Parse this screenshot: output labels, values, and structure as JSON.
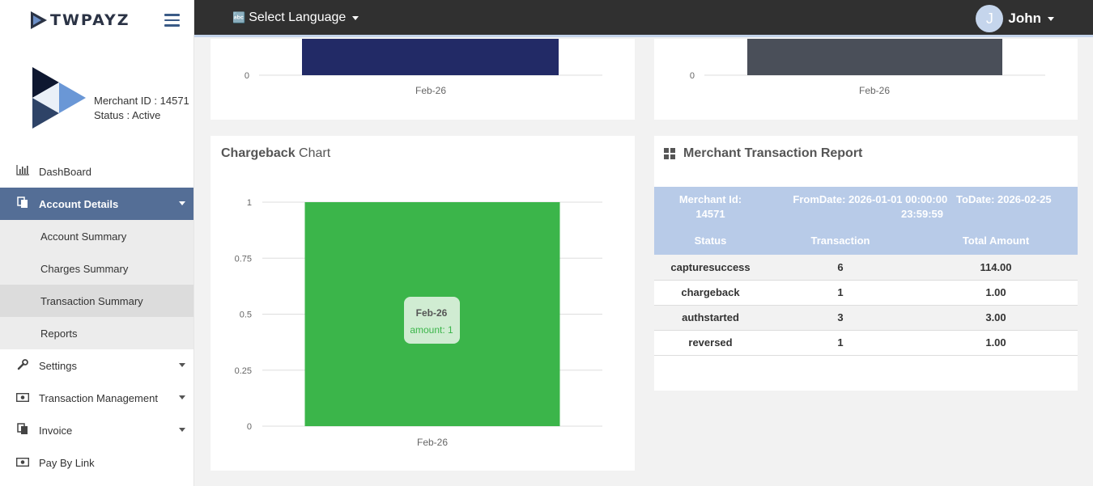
{
  "brand": {
    "name": "TWPAYZ"
  },
  "merchant": {
    "id_text": "Merchant ID : 14571",
    "status_text": "Status : Active"
  },
  "sidebar": {
    "items": [
      {
        "label": "DashBoard",
        "icon": "bar-chart-icon"
      },
      {
        "label": "Account Details",
        "icon": "file-copy-icon",
        "active": true,
        "children": [
          {
            "label": "Account Summary"
          },
          {
            "label": "Charges Summary"
          },
          {
            "label": "Transaction Summary",
            "selected": true
          },
          {
            "label": "Reports"
          }
        ]
      },
      {
        "label": "Settings",
        "icon": "wrench-icon"
      },
      {
        "label": "Transaction Management",
        "icon": "money-icon"
      },
      {
        "label": "Invoice",
        "icon": "file-copy-icon"
      },
      {
        "label": "Pay By Link",
        "icon": "money-icon"
      }
    ]
  },
  "topbar": {
    "language_label": "Select Language",
    "user_name": "John",
    "avatar_initial": "J"
  },
  "top_charts": {
    "left": {
      "zero_label": "0",
      "x_label": "Feb-26",
      "bar_color": "#222a66"
    },
    "right": {
      "zero_label": "0",
      "x_label": "Feb-26",
      "bar_color": "#4a4f59"
    }
  },
  "chargeback": {
    "title_bold": "Chargeback",
    "title_rest": " Chart",
    "tooltip": {
      "title": "Feb-26",
      "value_text": "amount: 1"
    }
  },
  "chart_data": [
    {
      "type": "bar",
      "title": "Chargeback Chart",
      "categories": [
        "Feb-26"
      ],
      "series": [
        {
          "name": "amount",
          "values": [
            1
          ]
        }
      ],
      "ylim": [
        0,
        1
      ],
      "yticks": [
        "0",
        "0.25",
        "0.5",
        "0.75",
        "1"
      ],
      "grid": true,
      "bar_color": "#3bb54a"
    }
  ],
  "report": {
    "title": "Merchant Transaction Report",
    "header": {
      "merchant_line1": "Merchant Id:",
      "merchant_line2": "14571",
      "range_line1": "FromDate: 2026-01-01 00:00:00   ToDate: 2026-02-25",
      "range_line2": "23:59:59"
    },
    "columns": [
      "Status",
      "Transaction",
      "Total Amount"
    ],
    "rows": [
      [
        "capturesuccess",
        "6",
        "114.00"
      ],
      [
        "chargeback",
        "1",
        "1.00"
      ],
      [
        "authstarted",
        "3",
        "3.00"
      ],
      [
        "reversed",
        "1",
        "1.00"
      ]
    ]
  }
}
